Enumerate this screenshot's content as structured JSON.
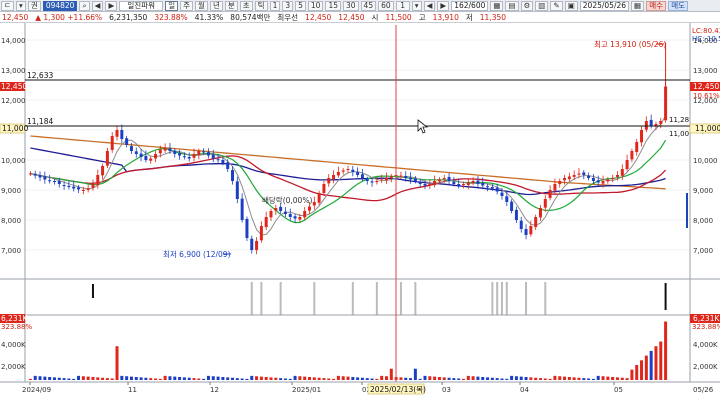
{
  "toolbar": {
    "items": [
      "ㄷ",
      "▾",
      "권",
      "",
      "◀",
      "▶",
      "일진파워",
      "일",
      "주",
      "월",
      "년",
      "분",
      "초",
      "틱",
      "1",
      "3",
      "5",
      "10",
      "15",
      "30",
      "45",
      "60",
      "1",
      "▾",
      "◀",
      "▶",
      "162/600",
      "",
      "",
      "",
      "",
      "",
      "",
      "",
      "2025/05/26",
      "",
      "매수",
      "매도"
    ],
    "code": "094820",
    "stock_name": "일진파워",
    "count": "162/600",
    "date": "2025/05/26",
    "buy": "매수",
    "sell": "매도"
  },
  "quote": {
    "price": "12,450",
    "change": "▲ 1,300 +11.66%",
    "volume": "6,231,350",
    "vol_ratio": "323.88%",
    "turnover": "41.33%",
    "amount": "80,574백만",
    "label_prev": "최우선",
    "prev_price": "12,450",
    "ask": "12,450",
    "label_open": "시",
    "open": "11,500",
    "label_high": "고",
    "high": "13,910",
    "label_low": "저",
    "low": "11,350"
  },
  "chart": {
    "y_ticks": [
      "14,000",
      "13,000",
      "12,000",
      "11,000",
      "10,000",
      "9,000",
      "8,000",
      "7,000"
    ],
    "hline_upper": "12,633",
    "hline_lower": "11,184",
    "current_price_tag": "12,450",
    "current_price_pct": "10.61%",
    "level_tag": "11,000",
    "level_tag2": "11,28",
    "level_tag3": "11,00",
    "lc_label": "LC:80.43",
    "hc_label": "HC:-10.50",
    "high_annotation": "최고 13,910 (05/26)",
    "low_annotation": "최저 6,900 (12/09)",
    "dividend_annotation": "배당락(0,00%)",
    "volume_ticks": [
      "4,000K",
      "2,000K"
    ],
    "volume_tag": "6,231K",
    "volume_pct_left": "323.88%",
    "volume_pct_right": "323.88%",
    "x_labels": [
      "2024/09",
      "11",
      "12",
      "2025/01",
      "02",
      "03",
      "04",
      "05",
      "05/26"
    ],
    "crosshair_label": "2025/02/13(목)",
    "colors": {
      "up": "#e0261a",
      "down": "#1a3fc4",
      "ma5": "#8c8c8c",
      "ma20": "#1faa35",
      "ma60": "#c0192c",
      "ma120": "#1e1e96",
      "ma240": "#c8702a",
      "crosshair": "#e04646"
    }
  },
  "chart_data": {
    "type": "candlestick",
    "y_range": [
      6500,
      14500
    ],
    "closes": [
      9550,
      9480,
      9420,
      9350,
      9300,
      9280,
      9200,
      9150,
      9100,
      9050,
      9020,
      9000,
      9050,
      9200,
      9500,
      9800,
      10300,
      10800,
      11000,
      10700,
      10500,
      10300,
      10200,
      10100,
      10000,
      10050,
      10200,
      10350,
      10400,
      10300,
      10200,
      10150,
      10100,
      10050,
      10200,
      10300,
      10250,
      10150,
      10050,
      10000,
      9900,
      9700,
      9300,
      8700,
      8000,
      7400,
      7000,
      7300,
      7800,
      8100,
      8300,
      8400,
      8300,
      8200,
      8100,
      8050,
      8100,
      8300,
      8450,
      8600,
      8900,
      9200,
      9400,
      9500,
      9600,
      9650,
      9700,
      9600,
      9500,
      9400,
      9300,
      9250,
      9300,
      9350,
      9400,
      9450,
      9500,
      9480,
      9400,
      9350,
      9300,
      9200,
      9150,
      9200,
      9300,
      9350,
      9400,
      9300,
      9200,
      9150,
      9200,
      9250,
      9300,
      9200,
      9150,
      9100,
      9050,
      8950,
      8800,
      8600,
      8300,
      8000,
      7700,
      7500,
      7800,
      8100,
      8400,
      8700,
      9000,
      9200,
      9300,
      9400,
      9450,
      9500,
      9550,
      9500,
      9400,
      9300,
      9250,
      9300,
      9350,
      9400,
      9500,
      9700,
      10000,
      10300,
      10600,
      11000,
      11300,
      11150,
      11200,
      11300,
      12450
    ],
    "high_point": {
      "date": "05/26",
      "value": 13910
    },
    "low_point": {
      "date": "12/09",
      "value": 6900
    }
  }
}
